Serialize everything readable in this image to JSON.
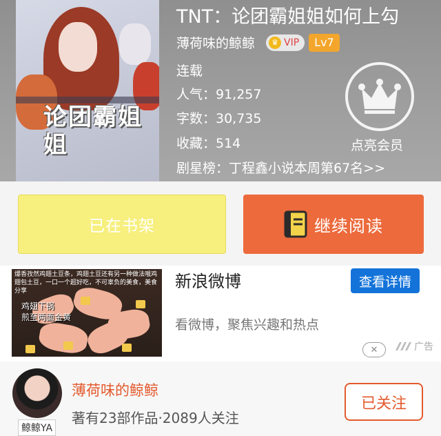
{
  "book": {
    "cover_text": "论团霸姐姐",
    "title": "TNT：论团霸姐姐如何上勾",
    "author": "薄荷味的鲸鲸",
    "vip_badge": "VIP",
    "level_badge": "Lv7",
    "status": "连载",
    "popularity": "人气：91,257",
    "word_count": "字数：30,735",
    "favorites": "收藏：514",
    "ranking": "剧星榜：丁程鑫小说本周第67名>>",
    "vip_cta": "点亮会员"
  },
  "actions": {
    "shelf_label": "已在书架",
    "read_label": "继续阅读"
  },
  "ad": {
    "thumb_text": "爆香孜然鸡翅土豆条，鸡翅土豆还有另一种做法哦鸡翅包土豆，一口一个超好吃，不可辜负的美食，美食分享",
    "thumb_caption": "鸡翅下锅\n煎至两面金黄",
    "title": "新浪微博",
    "detail_button": "查看详情",
    "description": "看微博，聚焦兴趣和热点",
    "close_symbol": "✕",
    "ad_label": "广告"
  },
  "author_card": {
    "avatar_tag": "鲸鲸YA",
    "name": "薄荷味的鲸鲸",
    "meta": "著有23部作品·2089人关注",
    "follow_button": "已关注"
  },
  "colors": {
    "shelf_bg": "#f7ef7e",
    "read_bg": "#ec6a3c",
    "weibo_blue": "#1473d9",
    "accent_orange": "#e35a2d"
  },
  "icons": [
    "crown-icon",
    "book-icon",
    "close-icon",
    "ad-logo-icon"
  ]
}
